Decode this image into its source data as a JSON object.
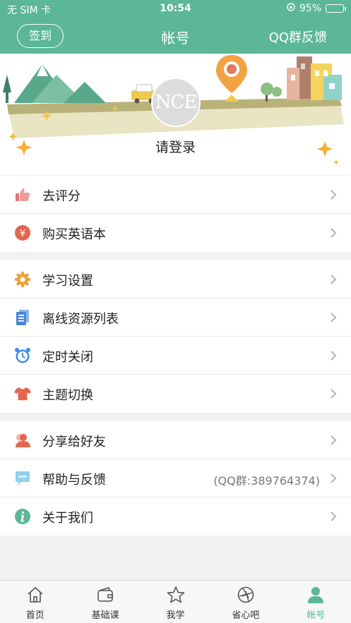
{
  "statusbar": {
    "carrier": "无 SIM 卡",
    "time": "10:54",
    "battery": "95%",
    "battery_level": 0.95
  },
  "navbar": {
    "signin_label": "签到",
    "title": "帐号",
    "feedback_label": "QQ群反馈"
  },
  "profile": {
    "avatar_text": "NCE",
    "login_label": "请登录"
  },
  "group1": [
    {
      "label": "去评分",
      "icon": "thumbs-up-icon"
    },
    {
      "label": "购买英语本",
      "icon": "yen-coin-icon"
    }
  ],
  "group2": [
    {
      "label": "学习设置",
      "icon": "gear-icon"
    },
    {
      "label": "离线资源列表",
      "icon": "document-list-icon"
    },
    {
      "label": "定时关闭",
      "icon": "alarm-clock-icon"
    },
    {
      "label": "主题切换",
      "icon": "tshirt-icon"
    }
  ],
  "group3": [
    {
      "label": "分享给好友",
      "icon": "share-person-icon"
    },
    {
      "label": "帮助与反馈",
      "icon": "chat-bubble-icon",
      "extra": "(QQ群:389764374)"
    },
    {
      "label": "关于我们",
      "icon": "info-icon"
    }
  ],
  "tabbar": [
    {
      "label": "首页",
      "icon": "home-icon"
    },
    {
      "label": "基础课",
      "icon": "wallet-icon"
    },
    {
      "label": "我学",
      "icon": "star-icon"
    },
    {
      "label": "省心吧",
      "icon": "aperture-icon"
    },
    {
      "label": "帐号",
      "icon": "person-icon",
      "active": true
    }
  ],
  "colors": {
    "accent": "#5bb796",
    "tab_active": "#5bb796"
  }
}
